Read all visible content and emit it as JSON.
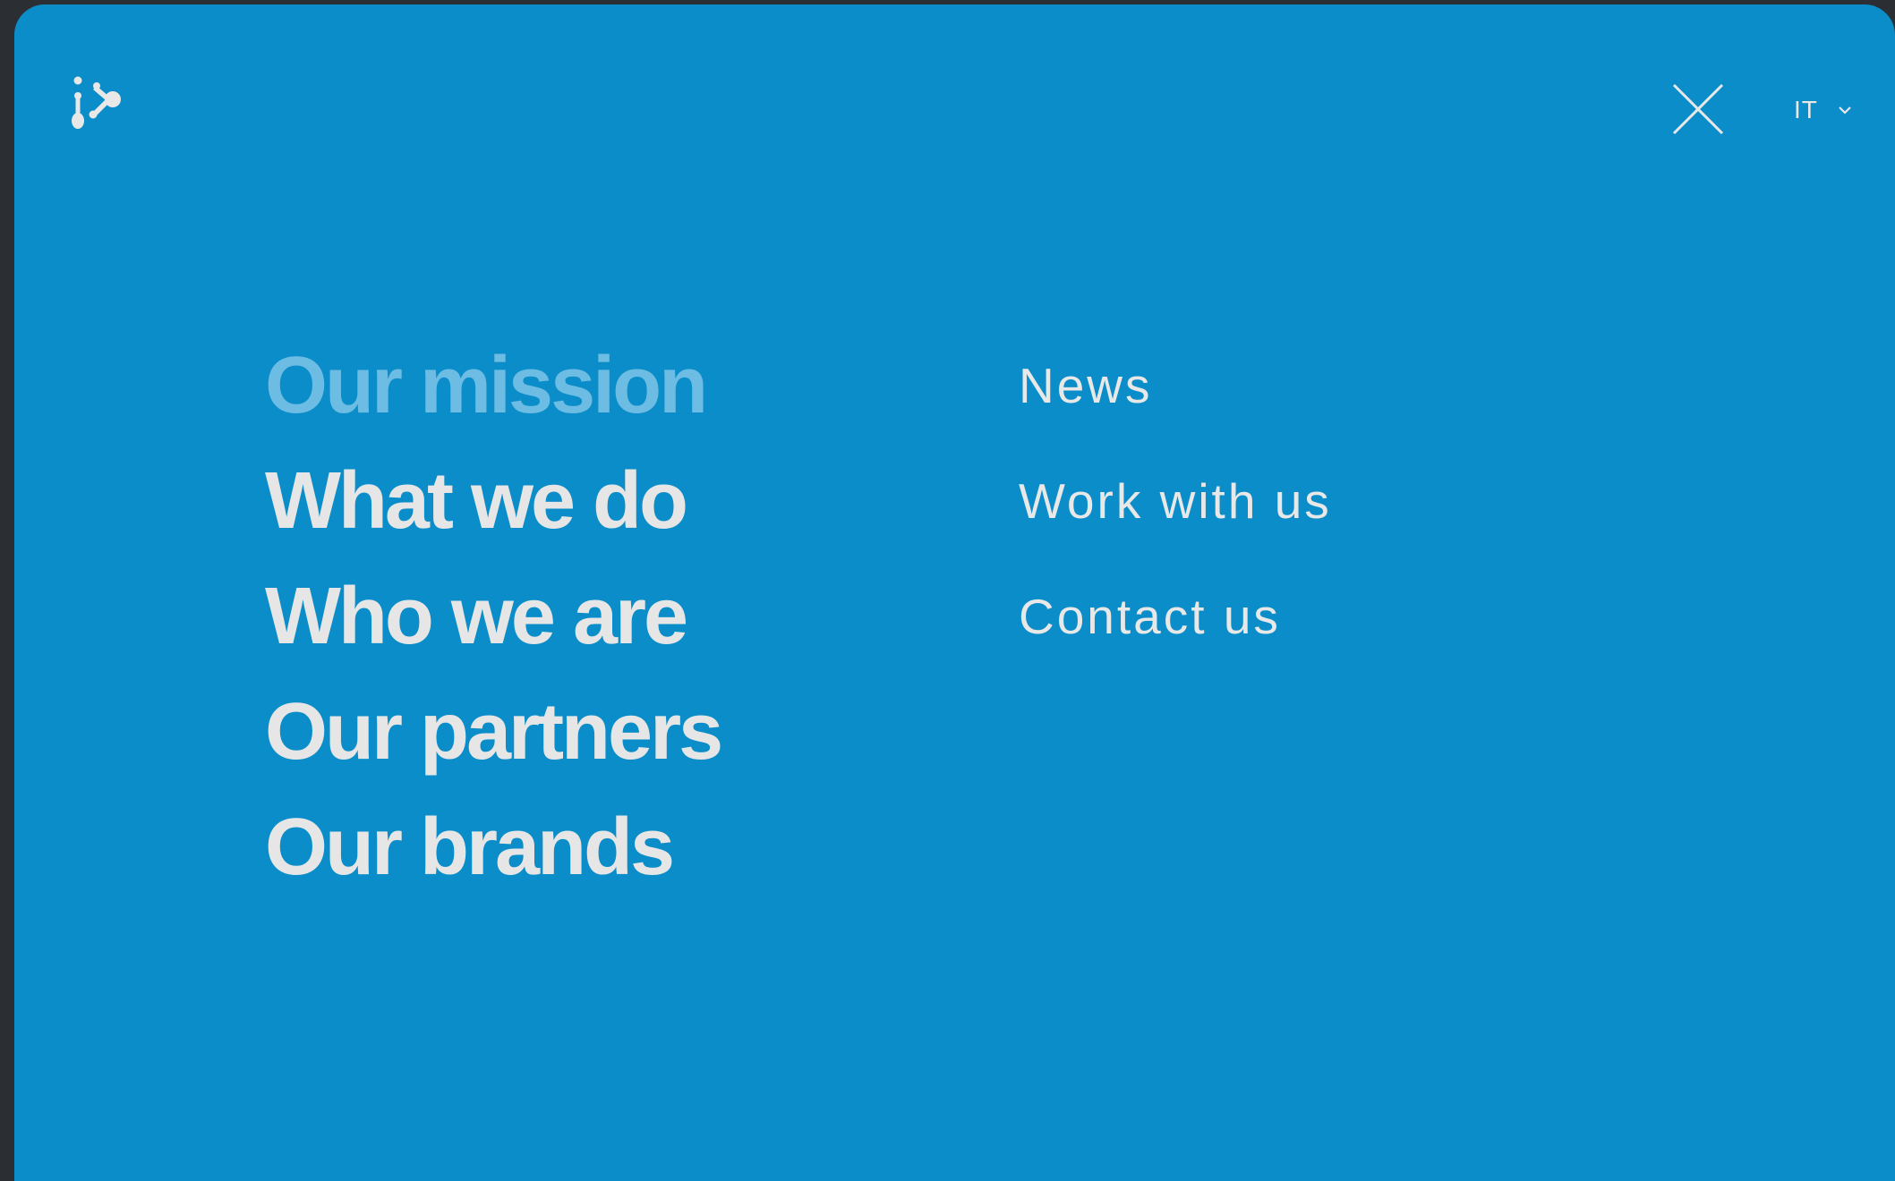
{
  "header": {
    "logo_icon": "brand-logo-icon",
    "close_icon": "close-icon",
    "language": {
      "selected": "IT",
      "icon": "chevron-down-icon"
    }
  },
  "menu": {
    "primary": [
      {
        "label": "Our mission",
        "active": true
      },
      {
        "label": "What we do",
        "active": false
      },
      {
        "label": "Who we are",
        "active": false
      },
      {
        "label": "Our partners",
        "active": false
      },
      {
        "label": "Our brands",
        "active": false
      }
    ],
    "secondary": [
      {
        "label": "News"
      },
      {
        "label": "Work with us"
      },
      {
        "label": "Contact us"
      }
    ]
  },
  "colors": {
    "background": "#0a8dc8",
    "text": "#e6e6e6",
    "active_text": "#6cbce3",
    "frame": "#2b2f33"
  }
}
